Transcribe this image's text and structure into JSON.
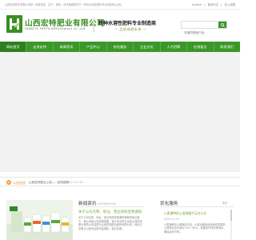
{
  "topbar": {
    "intro": "山西宏特肥业有限公司是一家集研发、生产、销售、科学施肥指导于一体的水溶性肥料专业制造商(山西)",
    "english": "English",
    "separator": "|",
    "chinese": "繁体中文",
    "favorite": "加入收藏"
  },
  "header": {
    "company_cn": "山西宏特肥业有限公司",
    "company_en": "HONGTE FERTILIZER(Shanxi) co.,Ltd.",
    "slogan": "特种水溶性肥料专业制造商",
    "subslogan": "品质成就未来",
    "search_placeholder": "关键词搜索产品...",
    "brand_color": "#3b9729"
  },
  "nav": {
    "items": [
      {
        "label": "网站首页"
      },
      {
        "label": "走进宏特"
      },
      {
        "label": "新闻资讯"
      },
      {
        "label": "产品中心"
      },
      {
        "label": "农化服务"
      },
      {
        "label": "企业文化"
      },
      {
        "label": "人才招聘"
      },
      {
        "label": "在线留言"
      },
      {
        "label": "联系我们"
      }
    ]
  },
  "notice": {
    "label": "公告信息",
    "text": "山西宏特肥业上线——宏特国际",
    "date": "2017-07-30"
  },
  "news": {
    "title": "新闻资讯",
    "title_en": "INFORMATION",
    "headline": "关于公司名称、地址、营业执照变更通知",
    "body": "关于公司名称、地址、营业执照变更通知尊敬的各位客户：我公司因公司发展需要，现公司名称已由原山西宏特肥业有限公司变更为山西宏特肥业股份有限公司，地址已变更为山西省运城市盐湖区，营业执照..."
  },
  "service": {
    "title": "农化服务",
    "more": "更多",
    "item_title": "小麦播种前土壤墒情不足怎么办",
    "item_date": "2020-11-09",
    "item_body": "小麦播种前土壤墒情不足，小麦对种植适宜墒情的要求，土壤相对含水量为70%~80%，需要及时浇好底墒水，确保足墒下种..."
  }
}
